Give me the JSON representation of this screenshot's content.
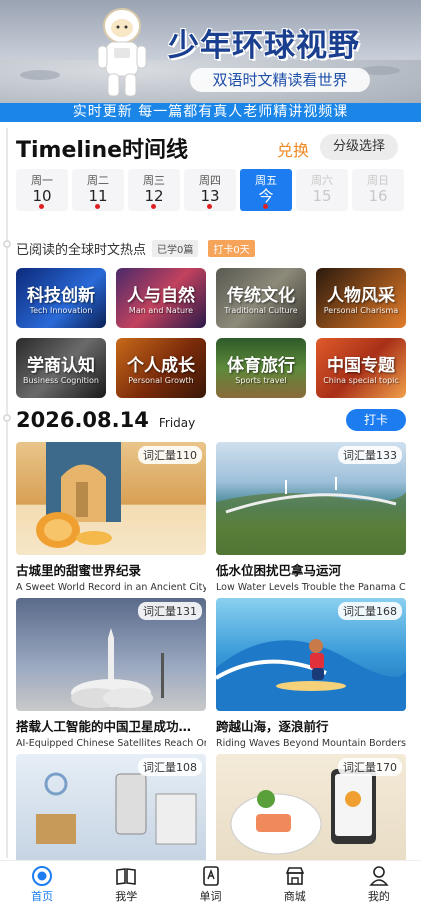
{
  "banner": {
    "title": "少年环球视野",
    "subtitle": "双语时文精读看世界",
    "promo": "实时更新 每一篇都有真人老师精讲视频课"
  },
  "timeline": {
    "title": "Timeline时间线",
    "exchange_label": "兑换",
    "level_select_label": "分级选择"
  },
  "week": [
    {
      "name": "周一",
      "num": "10",
      "state": "read"
    },
    {
      "name": "周二",
      "num": "11",
      "state": "read"
    },
    {
      "name": "周三",
      "num": "12",
      "state": "read"
    },
    {
      "name": "周四",
      "num": "13",
      "state": "read"
    },
    {
      "name": "周五",
      "num": "今",
      "state": "today"
    },
    {
      "name": "周六",
      "num": "15",
      "state": "future"
    },
    {
      "name": "周日",
      "num": "16",
      "state": "future"
    }
  ],
  "hot": {
    "label": "已阅读的全球时文热点",
    "learned_badge": "已学0篇",
    "checkin_badge": "打卡0天"
  },
  "categories": [
    {
      "cn": "科技创新",
      "en": "Tech Innovation"
    },
    {
      "cn": "人与自然",
      "en": "Man and Nature"
    },
    {
      "cn": "传统文化",
      "en": "Traditional Culture"
    },
    {
      "cn": "人物风采",
      "en": "Personal Charisma"
    },
    {
      "cn": "学商认知",
      "en": "Business Cognition"
    },
    {
      "cn": "个人成长",
      "en": "Personal Growth"
    },
    {
      "cn": "体育旅行",
      "en": "Sports travel"
    },
    {
      "cn": "中国专题",
      "en": "China special topic"
    }
  ],
  "date_section": {
    "date": "2026.08.14",
    "weekday": "Friday",
    "checkin_label": "打卡"
  },
  "articles": [
    {
      "vocab": "词汇量110",
      "cn": "古城里的甜蜜世界纪录",
      "en": "A Sweet World Record in an Ancient City"
    },
    {
      "vocab": "词汇量133",
      "cn": "低水位困扰巴拿马运河",
      "en": "Low Water Levels Trouble the Panama Canal"
    },
    {
      "vocab": "词汇量131",
      "cn": "搭载人工智能的中国卫星成功…",
      "en": "AI-Equipped Chinese Satellites Reach Orbit"
    },
    {
      "vocab": "词汇量168",
      "cn": "跨越山海，逐浪前行",
      "en": "Riding Waves Beyond Mountain Borders"
    },
    {
      "vocab": "词汇量108",
      "cn": "",
      "en": ""
    },
    {
      "vocab": "词汇量170",
      "cn": "",
      "en": ""
    }
  ],
  "tabbar": [
    {
      "label": "首页",
      "icon": "home-icon"
    },
    {
      "label": "我学",
      "icon": "book-icon"
    },
    {
      "label": "单词",
      "icon": "word-card-icon"
    },
    {
      "label": "商城",
      "icon": "shop-icon"
    },
    {
      "label": "我的",
      "icon": "profile-icon"
    }
  ],
  "colors": {
    "accent": "#1d7df0",
    "orange": "#f08a24",
    "red_dot": "#e02020"
  }
}
